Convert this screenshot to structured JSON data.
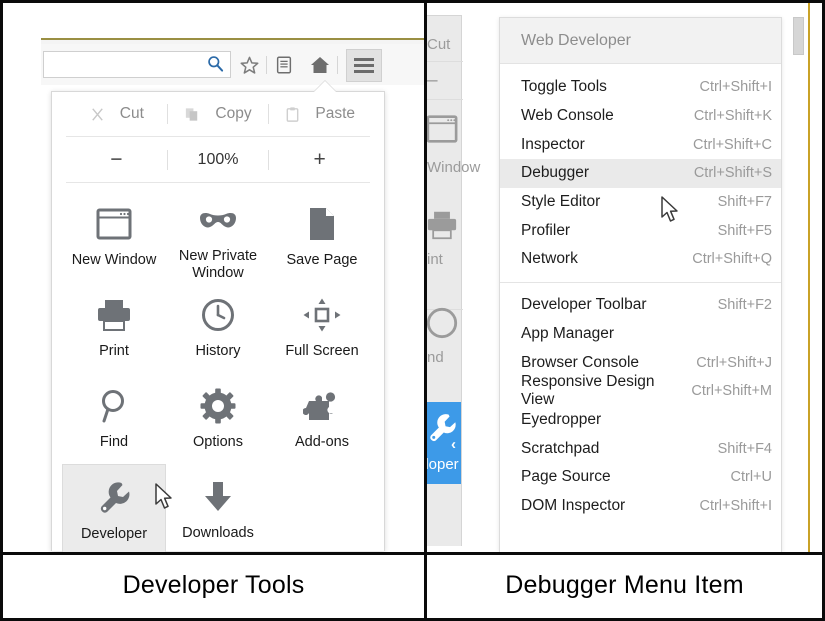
{
  "figure": {
    "caption_left": "Developer Tools",
    "caption_right": "Debugger Menu Item"
  },
  "left_panel": {
    "toolbar": {
      "search_value": "",
      "search_placeholder": "",
      "search_icon": "search-icon",
      "bookmark_icon": "star-icon",
      "reader_icon": "reading-list-icon",
      "home_icon": "home-icon",
      "menu_icon": "hamburger-menu-icon"
    },
    "edit_row": [
      {
        "label": "Cut",
        "icon": "scissors-icon",
        "enabled": false
      },
      {
        "label": "Copy",
        "icon": "copy-icon",
        "enabled": false
      },
      {
        "label": "Paste",
        "icon": "clipboard-icon",
        "enabled": false
      }
    ],
    "zoom_row": {
      "minus": "−",
      "level": "100%",
      "plus": "+"
    },
    "tiles": [
      {
        "label": "New Window",
        "icon": "window-icon"
      },
      {
        "label": "New Private Window",
        "icon": "mask-icon"
      },
      {
        "label": "Save Page",
        "icon": "page-icon"
      },
      {
        "label": "Print",
        "icon": "printer-icon"
      },
      {
        "label": "History",
        "icon": "clock-icon"
      },
      {
        "label": "Full Screen",
        "icon": "fullscreen-arrows-icon"
      },
      {
        "label": "Find",
        "icon": "magnifier-icon"
      },
      {
        "label": "Options",
        "icon": "gear-icon"
      },
      {
        "label": "Add-ons",
        "icon": "puzzle-piece-icon"
      },
      {
        "label": "Developer",
        "icon": "wrench-icon",
        "highlighted": true
      },
      {
        "label": "Downloads",
        "icon": "download-arrow-icon"
      }
    ]
  },
  "right_panel": {
    "parent_menu": {
      "cut_label": "Cut",
      "zoom_minus": "–",
      "new_window_label": "Window",
      "print_label": "int",
      "find_label": "nd",
      "developer_label": "loper",
      "developer_icon": "wrench-icon",
      "developer_chevron": "chevron-left-icon",
      "window_icon": "window-icon",
      "printer_icon": "printer-icon",
      "clock_icon": "clock-icon",
      "highlight_color": "#3d9ae8"
    },
    "submenu": {
      "title": "Web Developer",
      "groups": [
        [
          {
            "label": "Toggle Tools",
            "shortcut": "Ctrl+Shift+I"
          },
          {
            "label": "Web Console",
            "shortcut": "Ctrl+Shift+K"
          },
          {
            "label": "Inspector",
            "shortcut": "Ctrl+Shift+C"
          },
          {
            "label": "Debugger",
            "shortcut": "Ctrl+Shift+S",
            "selected": true
          },
          {
            "label": "Style Editor",
            "shortcut": "Shift+F7"
          },
          {
            "label": "Profiler",
            "shortcut": "Shift+F5"
          },
          {
            "label": "Network",
            "shortcut": "Ctrl+Shift+Q"
          }
        ],
        [
          {
            "label": "Developer Toolbar",
            "shortcut": "Shift+F2"
          },
          {
            "label": "App Manager",
            "shortcut": ""
          },
          {
            "label": "Browser Console",
            "shortcut": "Ctrl+Shift+J"
          },
          {
            "label": "Responsive Design View",
            "shortcut": "Ctrl+Shift+M"
          },
          {
            "label": "Eyedropper",
            "shortcut": ""
          },
          {
            "label": "Scratchpad",
            "shortcut": "Shift+F4"
          },
          {
            "label": "Page Source",
            "shortcut": "Ctrl+U"
          },
          {
            "label": "DOM Inspector",
            "shortcut": "Ctrl+Shift+I"
          }
        ]
      ]
    }
  },
  "colors": {
    "accent_blue": "#3d9ae8",
    "selection_gray": "#eaeaea",
    "icon_gray": "#6e7277",
    "rule_gold": "#c9a227"
  }
}
